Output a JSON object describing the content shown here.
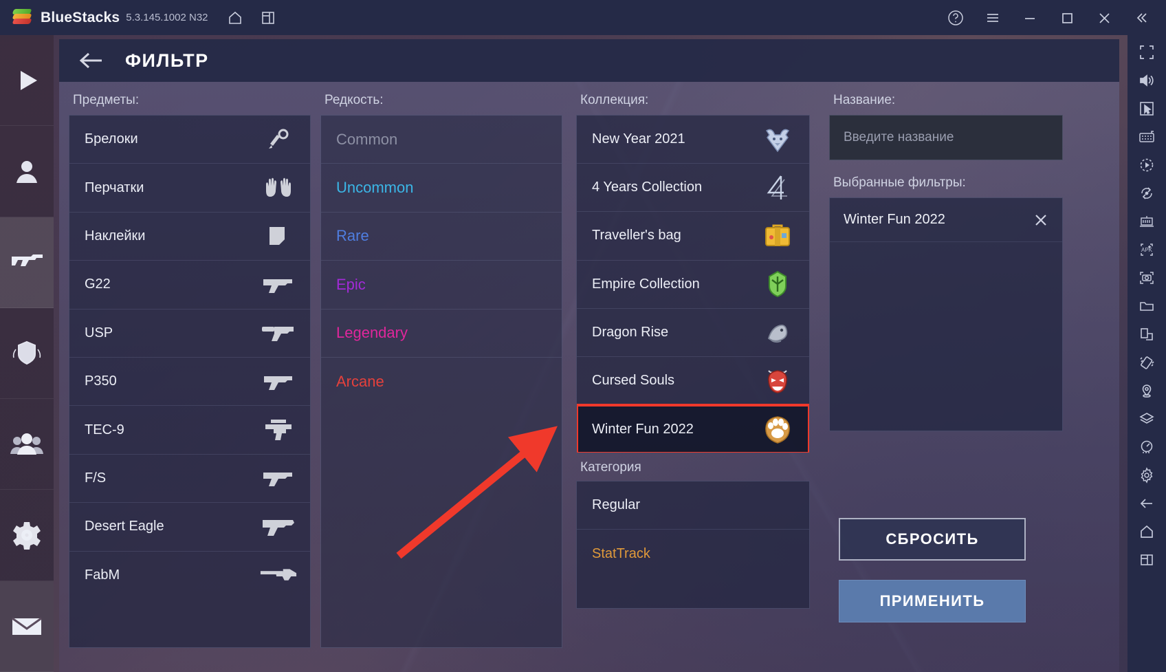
{
  "titlebar": {
    "app_name": "BlueStacks",
    "version": "5.3.145.1002 N32",
    "icons": [
      "home-icon",
      "multi-instance-icon"
    ],
    "right_icons": [
      "help-icon",
      "menu-icon",
      "minimize-icon",
      "maximize-icon",
      "close-icon",
      "collapse-icon"
    ]
  },
  "right_toolbar": {
    "items": [
      "fullscreen-icon",
      "volume-icon",
      "cursor-icon",
      "keyboard-icon",
      "macro-icon",
      "rotate-icon",
      "multi-instance-manager-icon",
      "install-apk-icon",
      "screenshot-icon",
      "media-folder-icon",
      "screen-split-icon",
      "shake-icon",
      "location-icon",
      "layers-icon",
      "performance-icon",
      "settings-icon",
      "back-icon",
      "home-icon",
      "recents-icon"
    ]
  },
  "game_nav": {
    "items": [
      {
        "name": "play",
        "active": false
      },
      {
        "name": "profile",
        "active": false
      },
      {
        "name": "weapons",
        "active": true
      },
      {
        "name": "rank",
        "active": false
      },
      {
        "name": "clan",
        "active": false
      },
      {
        "name": "settings",
        "active": false
      },
      {
        "name": "mail",
        "active": false
      }
    ]
  },
  "filter": {
    "title": "ФИЛЬТР",
    "back_label": "Назад",
    "items": {
      "label": "Предметы:",
      "rows": [
        {
          "label": "Брелоки",
          "icon": "keychain-icon"
        },
        {
          "label": "Перчатки",
          "icon": "gloves-icon"
        },
        {
          "label": "Наклейки",
          "icon": "sticker-icon"
        },
        {
          "label": "G22",
          "icon": "pistol-icon"
        },
        {
          "label": "USP",
          "icon": "pistol-silencer-icon"
        },
        {
          "label": "P350",
          "icon": "pistol-icon"
        },
        {
          "label": "TEC-9",
          "icon": "smg-icon"
        },
        {
          "label": "F/S",
          "icon": "pistol-icon"
        },
        {
          "label": "Desert Eagle",
          "icon": "deagle-icon"
        },
        {
          "label": "FabM",
          "icon": "shotgun-icon"
        }
      ]
    },
    "rarity": {
      "label": "Редкость:",
      "rows": [
        {
          "label": "Common",
          "color": "#8d90a4",
          "cls": "r-common"
        },
        {
          "label": "Uncommon",
          "color": "#3bb6e6",
          "cls": "r-uncommon"
        },
        {
          "label": "Rare",
          "color": "#4f7ee0",
          "cls": "r-rare"
        },
        {
          "label": "Epic",
          "color": "#a32ad8",
          "cls": "r-epic"
        },
        {
          "label": "Legendary",
          "color": "#e0269c",
          "cls": "r-legendary"
        },
        {
          "label": "Arcane",
          "color": "#e5413c",
          "cls": "r-arcane"
        }
      ]
    },
    "collection": {
      "label": "Коллекция:",
      "rows": [
        {
          "label": "New Year 2021",
          "icon": "bull-emblem-icon",
          "selected": false
        },
        {
          "label": "4 Years Collection",
          "icon": "four-emblem-icon",
          "selected": false
        },
        {
          "label": "Traveller's bag",
          "icon": "suitcase-icon",
          "selected": false
        },
        {
          "label": "Empire Collection",
          "icon": "empire-emblem-icon",
          "selected": false
        },
        {
          "label": "Dragon Rise",
          "icon": "dragon-icon",
          "selected": false
        },
        {
          "label": "Cursed Souls",
          "icon": "oni-mask-icon",
          "selected": false
        },
        {
          "label": "Winter Fun 2022",
          "icon": "paw-snow-icon",
          "selected": true
        }
      ]
    },
    "category": {
      "label": "Категория",
      "rows": [
        {
          "label": "Regular",
          "cls": ""
        },
        {
          "label": "StatTrack",
          "cls": "cat-stat"
        }
      ]
    },
    "name": {
      "label": "Название:",
      "placeholder": "Введите название",
      "value": ""
    },
    "selected_filters": {
      "label": "Выбранные фильтры:",
      "chips": [
        {
          "label": "Winter Fun 2022",
          "remove_icon": "close-icon"
        }
      ]
    },
    "buttons": {
      "reset": "СБРОСИТЬ",
      "apply": "ПРИМЕНИТЬ"
    }
  },
  "annotation": {
    "arrow_color": "#f0392b",
    "highlight_color": "#f0392b"
  }
}
